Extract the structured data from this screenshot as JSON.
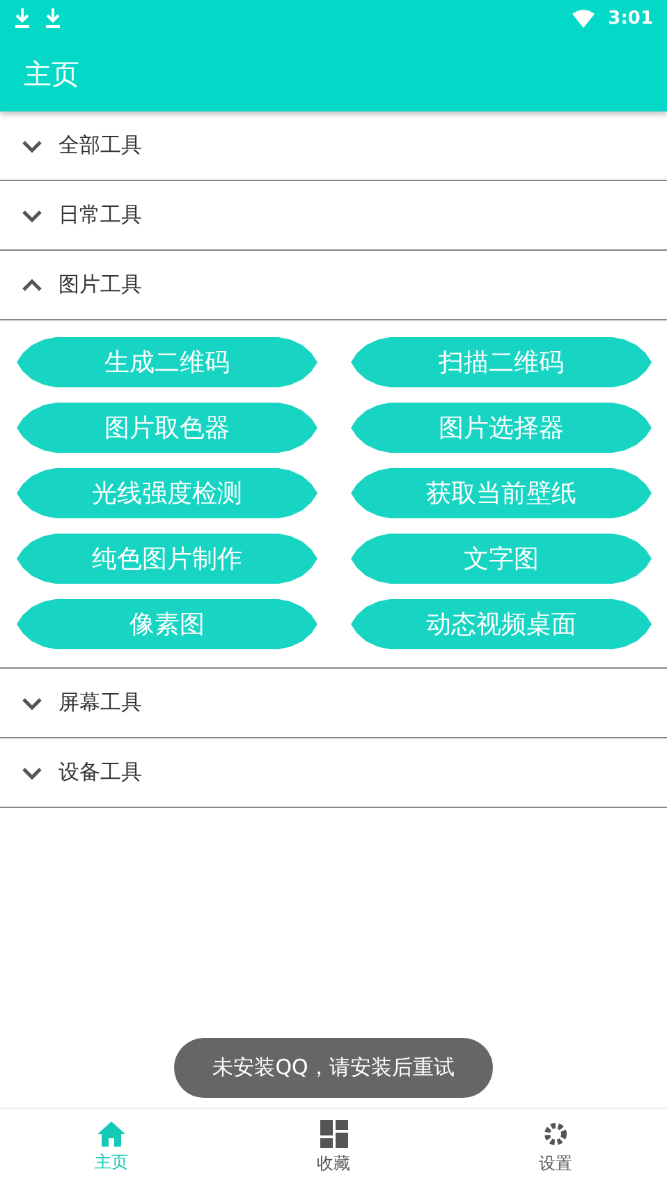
{
  "status_bar": {
    "time": "3:01"
  },
  "app_bar": {
    "title": "主页"
  },
  "sections": [
    {
      "title": "全部工具",
      "expanded": false
    },
    {
      "title": "日常工具",
      "expanded": false
    },
    {
      "title": "图片工具",
      "expanded": true,
      "tools": [
        "生成二维码",
        "扫描二维码",
        "图片取色器",
        "图片选择器",
        "光线强度检测",
        "获取当前壁纸",
        "纯色图片制作",
        "文字图",
        "像素图",
        "动态视频桌面"
      ]
    },
    {
      "title": "屏幕工具",
      "expanded": false
    },
    {
      "title": "设备工具",
      "expanded": false
    }
  ],
  "toast": "未安装QQ，请安装后重试",
  "bottom_nav": [
    {
      "label": "主页",
      "kind": "home",
      "selected": true
    },
    {
      "label": "收藏",
      "kind": "grid",
      "selected": false
    },
    {
      "label": "设置",
      "kind": "gear",
      "selected": false
    }
  ]
}
